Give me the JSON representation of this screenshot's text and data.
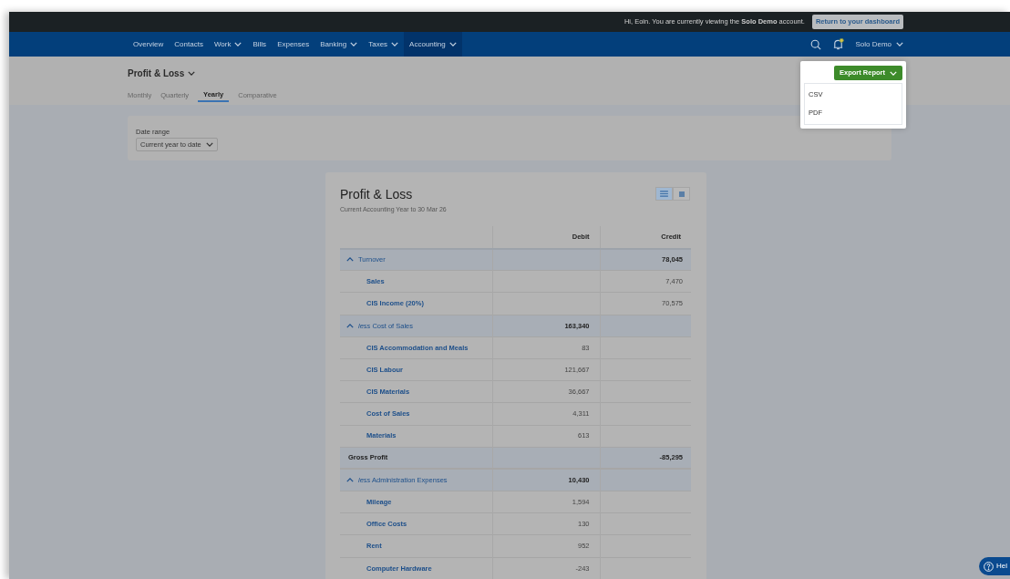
{
  "banner": {
    "message": "Hi, Eoin. You are currently viewing the **Solo Demo** account.",
    "button": "Return to your dashboard"
  },
  "nav": {
    "items": [
      {
        "label": "Overview",
        "dropdown": false,
        "selected": false
      },
      {
        "label": "Contacts",
        "dropdown": false,
        "selected": false
      },
      {
        "label": "Work",
        "dropdown": true,
        "selected": false
      },
      {
        "label": "Bills",
        "dropdown": false,
        "selected": false
      },
      {
        "label": "Expenses",
        "dropdown": false,
        "selected": false
      },
      {
        "label": "Banking",
        "dropdown": true,
        "selected": false
      },
      {
        "label": "Taxes",
        "dropdown": true,
        "selected": false
      },
      {
        "label": "Accounting",
        "dropdown": true,
        "selected": true
      }
    ],
    "account": "Solo Demo",
    "notification": true
  },
  "page": {
    "title": "Profit & Loss",
    "tabs": [
      {
        "label": "Monthly",
        "selected": false
      },
      {
        "label": "Quarterly",
        "selected": false
      },
      {
        "label": "Yearly",
        "selected": true
      },
      {
        "label": "Comparative",
        "selected": false
      }
    ]
  },
  "export": {
    "button": "Export Report",
    "menu": [
      "CSV",
      "PDF"
    ]
  },
  "filter": {
    "label": "Date range",
    "value": "Current year to date"
  },
  "report": {
    "title": "Profit & Loss",
    "subtitle": "Current Accounting Year to 30 Mar 26",
    "views": [
      {
        "kind": "list",
        "selected": true
      },
      {
        "kind": "block",
        "selected": false
      }
    ],
    "columns": [
      "Debit",
      "Credit"
    ],
    "rows": [
      {
        "kind": "section",
        "label": "Turnover",
        "expanded": true,
        "debit": "",
        "credit": "78,045"
      },
      {
        "kind": "item",
        "label": "Sales",
        "debit": "",
        "credit": "7,470"
      },
      {
        "kind": "item",
        "label": "CIS Income (20%)",
        "debit": "",
        "credit": "70,575"
      },
      {
        "kind": "section",
        "label": "*less* Cost of Sales",
        "expanded": true,
        "debit": "163,340",
        "credit": ""
      },
      {
        "kind": "item",
        "label": "CIS Accommodation and Meals",
        "debit": "83",
        "credit": ""
      },
      {
        "kind": "item",
        "label": "CIS Labour",
        "debit": "121,667",
        "credit": ""
      },
      {
        "kind": "item",
        "label": "CIS Materials",
        "debit": "36,667",
        "credit": ""
      },
      {
        "kind": "item",
        "label": "Cost of Sales",
        "debit": "4,311",
        "credit": ""
      },
      {
        "kind": "item",
        "label": "Materials",
        "debit": "613",
        "credit": ""
      },
      {
        "kind": "total",
        "label": "Gross Profit",
        "debit": "",
        "credit": "-85,295"
      },
      {
        "kind": "section",
        "label": "*less* Administration Expenses",
        "expanded": true,
        "debit": "10,430",
        "credit": ""
      },
      {
        "kind": "item",
        "label": "Mileage",
        "debit": "1,594",
        "credit": ""
      },
      {
        "kind": "item",
        "label": "Office Costs",
        "debit": "130",
        "credit": ""
      },
      {
        "kind": "item",
        "label": "Rent",
        "debit": "952",
        "credit": ""
      },
      {
        "kind": "item",
        "label": "Computer Hardware",
        "debit": "-243",
        "credit": ""
      }
    ]
  },
  "help": {
    "label": "Hel"
  }
}
